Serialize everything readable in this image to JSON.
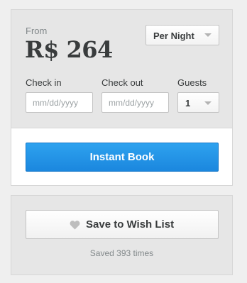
{
  "booking": {
    "from_label": "From",
    "price": "R$ 264",
    "rate_select": {
      "selected": "Per Night"
    },
    "checkin": {
      "label": "Check in",
      "placeholder": "mm/dd/yyyy"
    },
    "checkout": {
      "label": "Check out",
      "placeholder": "mm/dd/yyyy"
    },
    "guests": {
      "label": "Guests",
      "selected": "1"
    },
    "instant_book_label": "Instant Book"
  },
  "wishlist": {
    "button_label": "Save to Wish List",
    "icon": "heart-icon",
    "saved_text": "Saved 393 times"
  },
  "colors": {
    "primary_button": "#1b87de",
    "panel_bg": "#e6e6e6",
    "page_bg": "#efefef",
    "text": "#393c3d",
    "muted_text": "#82888a"
  }
}
